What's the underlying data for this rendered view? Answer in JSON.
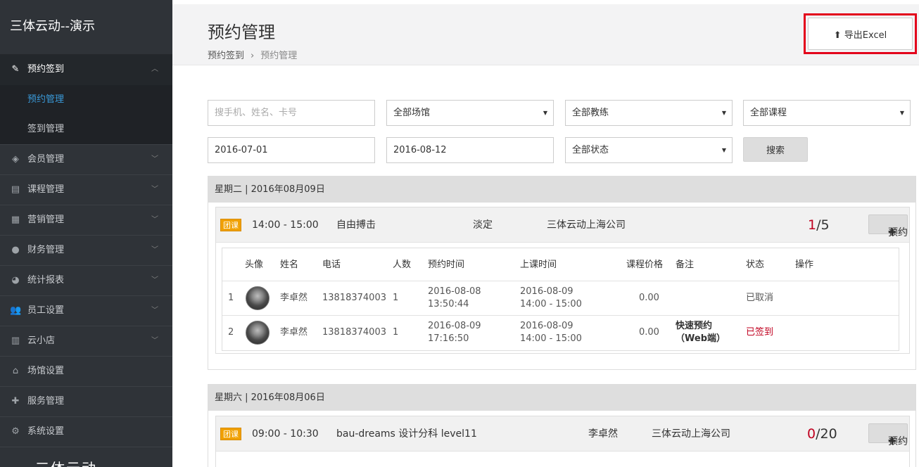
{
  "sidebar": {
    "brand": "三体云动--演示",
    "items": [
      {
        "label": "预约签到",
        "icon": "pencil-icon"
      },
      {
        "label": "会员管理",
        "icon": "layers-icon"
      },
      {
        "label": "课程管理",
        "icon": "clipboard-icon"
      },
      {
        "label": "营销管理",
        "icon": "store-icon"
      },
      {
        "label": "财务管理",
        "icon": "money-bag-icon"
      },
      {
        "label": "统计报表",
        "icon": "pie-chart-icon"
      },
      {
        "label": "员工设置",
        "icon": "users-icon"
      },
      {
        "label": "云小店",
        "icon": "receipt-icon"
      },
      {
        "label": "场馆设置",
        "icon": "home-icon"
      },
      {
        "label": "服务管理",
        "icon": "puzzle-icon"
      },
      {
        "label": "系统设置",
        "icon": "gear-icon"
      }
    ],
    "subitems": [
      {
        "label": "预约管理"
      },
      {
        "label": "签到管理"
      }
    ],
    "bottom_logo": "三体云动"
  },
  "header": {
    "title": "预约管理",
    "breadcrumb": [
      "预约签到",
      "预约管理"
    ],
    "export_label": "导出Excel"
  },
  "filters": {
    "search_placeholder": "搜手机、姓名、卡号",
    "venue": "全部场馆",
    "coach": "全部教练",
    "course": "全部课程",
    "date_from": "2016-07-01",
    "date_to": "2016-08-12",
    "status": "全部状态",
    "search_label": "搜索"
  },
  "columns": [
    "头像",
    "姓名",
    "电话",
    "人数",
    "预约时间",
    "上课时间",
    "课程价格",
    "备注",
    "状态",
    "操作"
  ],
  "days": [
    {
      "date_label": "星期二 | 2016年08月09日",
      "course": {
        "tag": "团课",
        "time": "14:00 - 15:00",
        "name": "自由搏击",
        "coach": "淡定",
        "company": "三体云动上海公司",
        "booked": "1",
        "capacity": "/5",
        "book_label": "预约"
      },
      "rows": [
        {
          "idx": "1",
          "name": "李卓然",
          "phone": "13818374003",
          "count": "1",
          "book_date": "2016-08-08",
          "book_time": "13:50:44",
          "class_date": "2016-08-09",
          "class_time": "14:00 - 15:00",
          "price": "0.00",
          "note1": "",
          "note2": "",
          "status": "已取消",
          "status_color": "#555555"
        },
        {
          "idx": "2",
          "name": "李卓然",
          "phone": "13818374003",
          "count": "1",
          "book_date": "2016-08-09",
          "book_time": "17:16:50",
          "class_date": "2016-08-09",
          "class_time": "14:00 - 15:00",
          "price": "0.00",
          "note1": "快速预约",
          "note2": "（Web端）",
          "status": "已签到",
          "status_color": "#c0001f"
        }
      ]
    },
    {
      "date_label": "星期六 | 2016年08月06日",
      "course": {
        "tag": "团课",
        "time": "09:00 - 10:30",
        "name": "bau-dreams 设计分科 level11",
        "coach": "李卓然",
        "company": "三体云动上海公司",
        "booked": "0",
        "capacity": "/20",
        "book_label": "预约"
      }
    }
  ]
}
